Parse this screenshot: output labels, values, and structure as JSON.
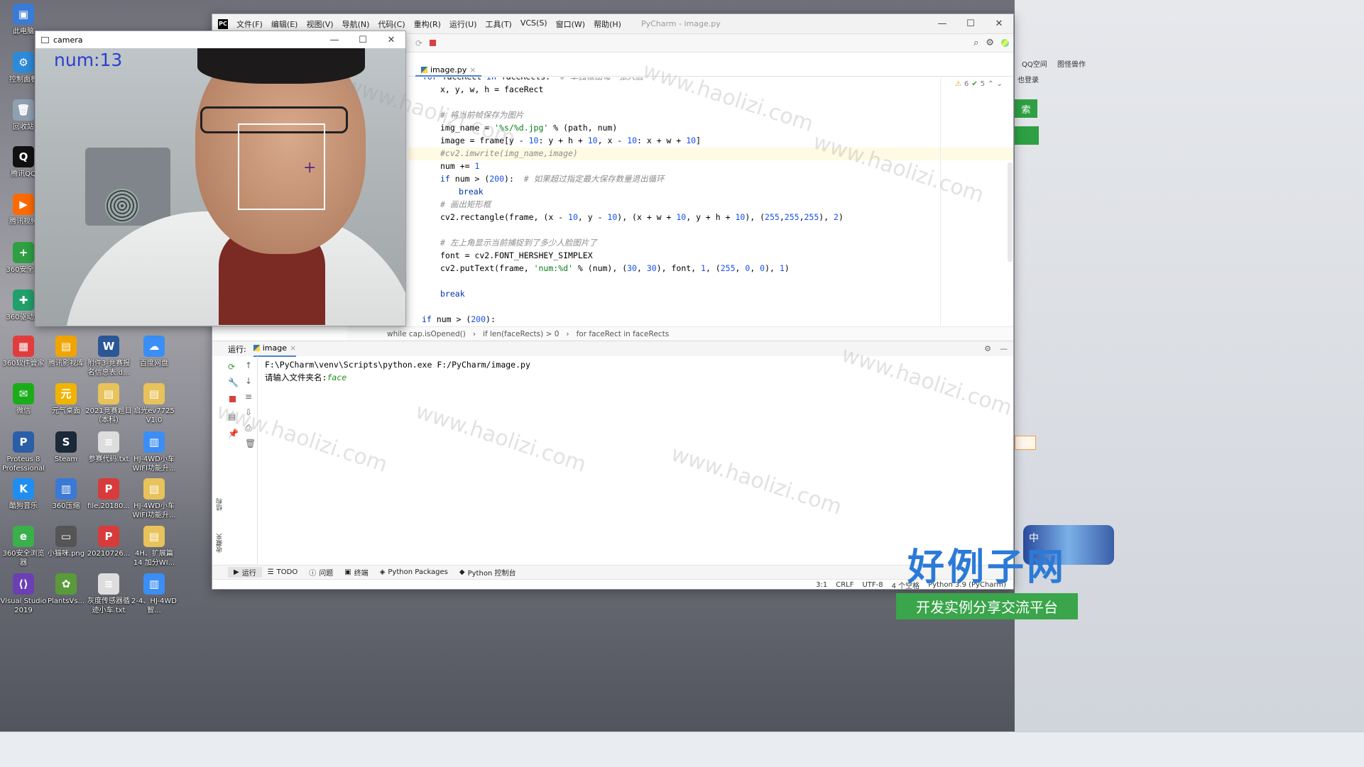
{
  "desktop_icons": [
    {
      "label": "此电脑",
      "color": "#3a7bd5",
      "glyph": "▣"
    },
    {
      "label": "控制面板",
      "color": "#2d8ad8",
      "glyph": "⚙"
    },
    {
      "label": "回收站",
      "color": "#8fa0b0",
      "glyph": "🗑"
    },
    {
      "label": "腾讯QQ",
      "color": "#111",
      "glyph": "Q"
    },
    {
      "label": "腾讯视频",
      "color": "#ff6a00",
      "glyph": "▶"
    },
    {
      "label": "360安全卫",
      "color": "#2ea043",
      "glyph": "+"
    },
    {
      "label": "360驱动大",
      "color": "#22a06b",
      "glyph": "✚"
    },
    {
      "label": "360软件管家",
      "color": "#e23d3d",
      "glyph": "▦"
    },
    {
      "label": "腾讯影视库",
      "color": "#f0a500",
      "glyph": "▤"
    },
    {
      "label": "附件3-竞赛报名信息表.d...",
      "color": "#2b5797",
      "glyph": "W"
    },
    {
      "label": "百度网盘",
      "color": "#3b8ef5",
      "glyph": "☁"
    },
    {
      "label": "微信",
      "color": "#1aad19",
      "glyph": "✉"
    },
    {
      "label": "元气桌面",
      "color": "#f0b400",
      "glyph": "元"
    },
    {
      "label": "2021竞赛题目（本科）",
      "color": "#e8c25a",
      "glyph": "▤"
    },
    {
      "label": "启光ev7725 V1.0",
      "color": "#e8c25a",
      "glyph": "▤"
    },
    {
      "label": "Proteus 8 Professional",
      "color": "#2a5fa8",
      "glyph": "P"
    },
    {
      "label": "Steam",
      "color": "#1b2838",
      "glyph": "S"
    },
    {
      "label": "参赛代码.txt",
      "color": "#dddddd",
      "glyph": "≡"
    },
    {
      "label": "HJ-4WD小车WIFI功能升...",
      "color": "#3b8ef5",
      "glyph": "▥"
    },
    {
      "label": "酷狗音乐",
      "color": "#1f8ef1",
      "glyph": "K"
    },
    {
      "label": "360压缩",
      "color": "#3a79d6",
      "glyph": "▥"
    },
    {
      "label": "file.20180...",
      "color": "#d83b3b",
      "glyph": "P"
    },
    {
      "label": "HJ-4WD小车WIFI功能升...",
      "color": "#e8c25a",
      "glyph": "▤"
    },
    {
      "label": "360安全浏览器",
      "color": "#3ab04a",
      "glyph": "e"
    },
    {
      "label": "小猫咪.png",
      "color": "#555",
      "glyph": "▭"
    },
    {
      "label": "20210726...",
      "color": "#d83b3b",
      "glyph": "P"
    },
    {
      "label": "4H、扩展篇14 加分WI...",
      "color": "#e8c25a",
      "glyph": "▤"
    },
    {
      "label": "Visual Studio 2019",
      "color": "#6c3fb5",
      "glyph": "⟨⟩"
    },
    {
      "label": "PlantsVs...",
      "color": "#5a9a3a",
      "glyph": "✿"
    },
    {
      "label": "灰度传感器循迹小车.txt",
      "color": "#dddddd",
      "glyph": "≡"
    },
    {
      "label": "2-4、HJ-4WD智...",
      "color": "#3b8ef5",
      "glyph": "▥"
    }
  ],
  "camera": {
    "title": "camera",
    "overlay_text": "num:13"
  },
  "pycharm": {
    "menu": [
      "文件(F)",
      "编辑(E)",
      "视图(V)",
      "导航(N)",
      "代码(C)",
      "重构(R)",
      "运行(U)",
      "工具(T)",
      "VCS(S)",
      "窗口(W)",
      "帮助(H)"
    ],
    "title": "PyCharm - image.py",
    "tab": "image.py",
    "inspection": {
      "warnings": "6",
      "ok": "5"
    },
    "breadcrumb": [
      "while cap.isOpened()",
      "if len(faceRects) > 0",
      "for faceRect in faceRects"
    ],
    "run_label": "运行:",
    "run_tab": "image",
    "console": {
      "line1": "F:\\PyCharm\\venv\\Scripts\\python.exe F:/PyCharm/image.py",
      "prompt": "请输入文件夹名:",
      "input": "face"
    },
    "bottom_tabs": [
      "运行",
      "TODO",
      "问题",
      "终端",
      "Python Packages",
      "Python 控制台"
    ],
    "side_labels": [
      "结构",
      "收藏夹"
    ],
    "status": [
      "3:1",
      "CRLF",
      "UTF-8",
      "4 个空格",
      "Python 3.9 (PyCharm)"
    ]
  },
  "background_window": {
    "labels": [
      "QQ空间",
      "图怪兽作",
      "也登录",
      "索",
      "中"
    ]
  },
  "watermark": {
    "text": "www.haolizi.com",
    "brand": "好例子网",
    "slogan": "开发实例分享交流平台"
  },
  "colors": {
    "accent": "#4a83d4",
    "keyword": "#0033b3",
    "string": "#067d17",
    "number": "#1750eb",
    "comment": "#8c8c8c"
  }
}
